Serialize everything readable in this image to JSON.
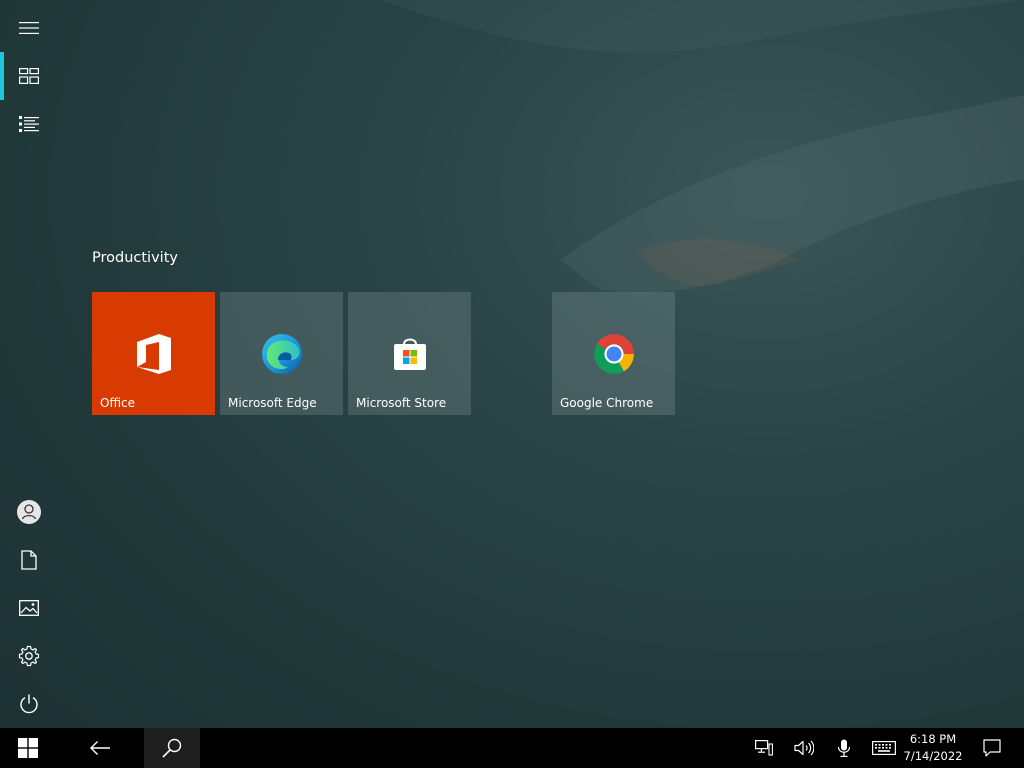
{
  "start": {
    "group_title": "Productivity",
    "tiles": [
      {
        "label": "Office",
        "icon": "office-icon",
        "color": "#d83b01"
      },
      {
        "label": "Microsoft Edge",
        "icon": "edge-icon"
      },
      {
        "label": "Microsoft Store",
        "icon": "store-icon"
      },
      {
        "label": "Google Chrome",
        "icon": "chrome-icon"
      }
    ],
    "rail_top": [
      "hamburger-menu-icon",
      "pinned-tiles-icon",
      "all-apps-list-icon"
    ],
    "rail_bottom": [
      "user-account-icon",
      "documents-icon",
      "pictures-icon",
      "settings-gear-icon",
      "power-icon"
    ],
    "accent": "#1ec8d6"
  },
  "taskbar": {
    "time": "6:18 PM",
    "date": "7/14/2022",
    "buttons": [
      "windows-start-icon",
      "back-arrow-icon",
      "search-icon"
    ],
    "tray": [
      "network-icon",
      "volume-icon",
      "microphone-icon",
      "touch-keyboard-icon",
      "action-center-icon"
    ]
  }
}
